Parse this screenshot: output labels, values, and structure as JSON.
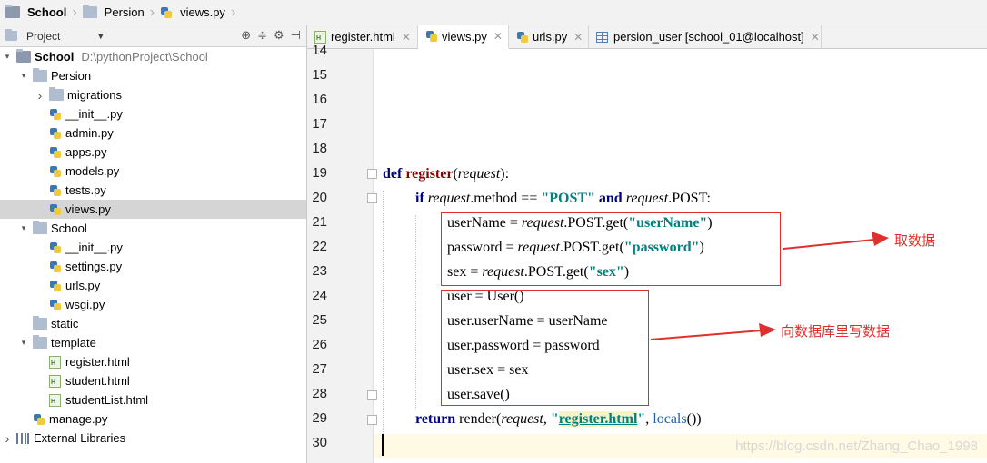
{
  "breadcrumb": [
    "School",
    "Persion",
    "views.py"
  ],
  "project_panel": {
    "title": "Project",
    "tree": [
      {
        "label": "School",
        "path": "D:\\pythonProject\\School",
        "level": 0,
        "kind": "folder",
        "expanded": true
      },
      {
        "label": "Persion",
        "level": 1,
        "kind": "folder",
        "expanded": true
      },
      {
        "label": "migrations",
        "level": 2,
        "kind": "folder",
        "expanded": false
      },
      {
        "label": "__init__.py",
        "level": 2,
        "kind": "py"
      },
      {
        "label": "admin.py",
        "level": 2,
        "kind": "py"
      },
      {
        "label": "apps.py",
        "level": 2,
        "kind": "py"
      },
      {
        "label": "models.py",
        "level": 2,
        "kind": "py"
      },
      {
        "label": "tests.py",
        "level": 2,
        "kind": "py"
      },
      {
        "label": "views.py",
        "level": 2,
        "kind": "py",
        "selected": true
      },
      {
        "label": "School",
        "level": 1,
        "kind": "folder",
        "expanded": true
      },
      {
        "label": "__init__.py",
        "level": 2,
        "kind": "py"
      },
      {
        "label": "settings.py",
        "level": 2,
        "kind": "py"
      },
      {
        "label": "urls.py",
        "level": 2,
        "kind": "py"
      },
      {
        "label": "wsgi.py",
        "level": 2,
        "kind": "py"
      },
      {
        "label": "static",
        "level": 1,
        "kind": "folder"
      },
      {
        "label": "template",
        "level": 1,
        "kind": "folder",
        "expanded": true
      },
      {
        "label": "register.html",
        "level": 2,
        "kind": "html"
      },
      {
        "label": "student.html",
        "level": 2,
        "kind": "html"
      },
      {
        "label": "studentList.html",
        "level": 2,
        "kind": "html"
      },
      {
        "label": "manage.py",
        "level": 1,
        "kind": "py"
      },
      {
        "label": "External Libraries",
        "level": 0,
        "kind": "lib",
        "expanded": false
      }
    ]
  },
  "tabs": [
    {
      "label": "register.html",
      "icon": "html-file-icon",
      "active": false
    },
    {
      "label": "views.py",
      "icon": "python-file-icon",
      "active": true
    },
    {
      "label": "urls.py",
      "icon": "python-file-icon",
      "active": false
    },
    {
      "label": "persion_user [school_01@localhost]",
      "icon": "table-icon",
      "active": false
    }
  ],
  "line_numbers": [
    "14",
    "15",
    "16",
    "17",
    "18",
    "19",
    "20",
    "21",
    "22",
    "23",
    "24",
    "25",
    "26",
    "27",
    "28",
    "29",
    "30"
  ],
  "code": {
    "def_kw": "def",
    "def_name": "register",
    "def_open": "(",
    "def_param": "request",
    "def_close": "):",
    "l20_if": "if",
    "l20_req": "request",
    "l20_mid": ".method == ",
    "l20_post": "\"POST\"",
    "l20_and": "and",
    "l20_req2": "request",
    "l20_tail": ".POST:",
    "l21_a": "userName = ",
    "l21_req": "request",
    "l21_b": ".POST.get(",
    "l21_s": "\"userName\"",
    "l21_c": ")",
    "l22_a": "password = ",
    "l22_req": "request",
    "l22_b": ".POST.get(",
    "l22_s": "\"password\"",
    "l22_c": ")",
    "l23_a": "sex = ",
    "l23_req": "request",
    "l23_b": ".POST.get(",
    "l23_s": "\"sex\"",
    "l23_c": ")",
    "l24": "user = User()",
    "l25": "user.userName = userName",
    "l26": "user.password = password",
    "l27": "user.sex = sex",
    "l28": "user.save()",
    "l29_ret": "return",
    "l29_a": "render(",
    "l29_req": "request",
    "l29_b": ", ",
    "l29_q1": "\"",
    "l29_tpl": "register.html",
    "l29_q2": "\"",
    "l29_c": ", ",
    "l29_loc": "locals",
    "l29_d": "())"
  },
  "annotations": {
    "get_data": "取数据",
    "write_data": "向数据库里写数据"
  },
  "watermark": "https://blog.csdn.net/Zhang_Chao_1998",
  "colors": {
    "annotation": "#e0302e",
    "keyword": "#000080",
    "string": "#008080",
    "function_name": "#8b0000"
  }
}
